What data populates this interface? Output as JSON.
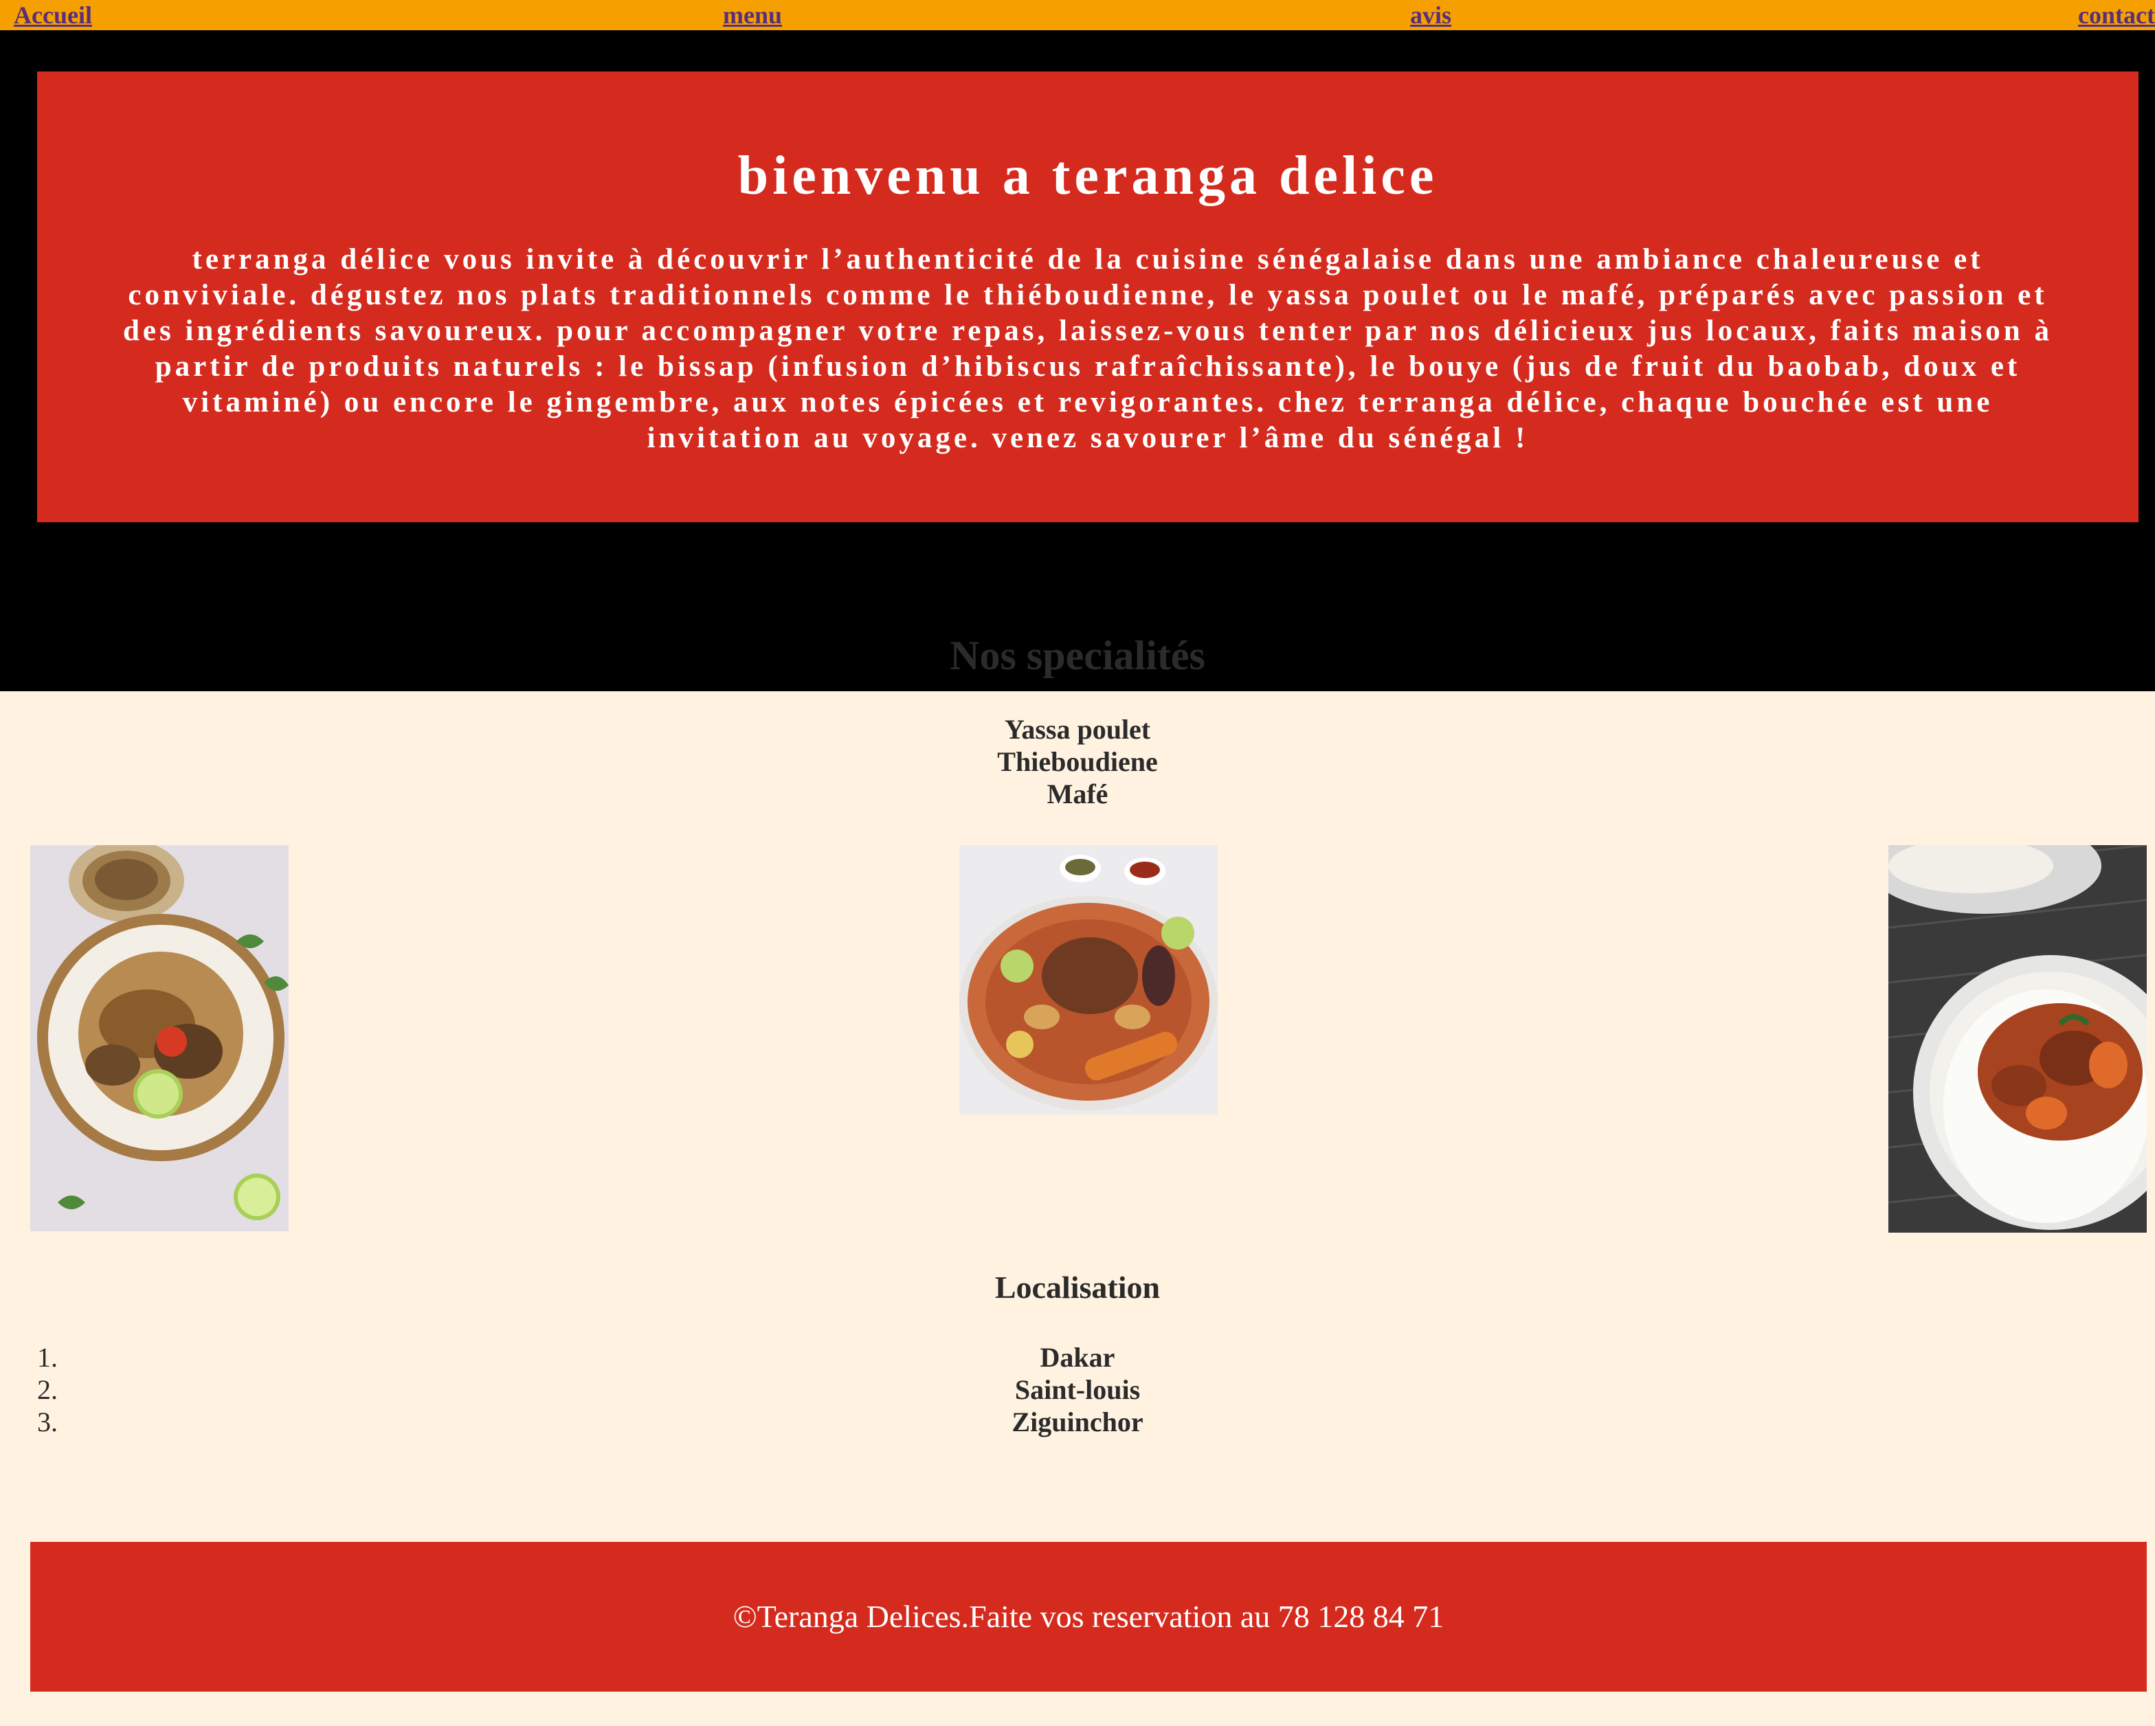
{
  "nav": {
    "items": [
      {
        "label": "Accueil"
      },
      {
        "label": "menu"
      },
      {
        "label": "avis"
      },
      {
        "label": "contact"
      }
    ]
  },
  "hero": {
    "title": "bienvenu a teranga delice",
    "text": "terranga délice vous invite à découvrir l’authenticité de la cuisine sénégalaise dans une ambiance chaleureuse et conviviale. dégustez nos plats traditionnels comme le thiéboudienne, le yassa poulet ou le mafé, préparés avec passion et des ingrédients savoureux. pour accompagner votre repas, laissez-vous tenter par nos délicieux jus locaux, faits maison à partir de produits naturels : le bissap (infusion d’hibiscus rafraîchissante), le bouye (jus de fruit du baobab, doux et vitaminé) ou encore le gingembre, aux notes épicées et revigorantes. chez terranga délice, chaque bouchée est une invitation au voyage. venez savourer l’âme du sénégal !"
  },
  "specialties": {
    "title": "Nos specialités",
    "dishes": [
      "Yassa poulet",
      "Thieboudiene",
      "Mafé"
    ]
  },
  "localisation": {
    "title": "Localisation",
    "numbers": [
      "1.",
      "2.",
      "3."
    ],
    "cities": [
      "Dakar",
      "Saint-louis",
      "Ziguinchor"
    ]
  },
  "footer": {
    "text": "©Teranga Delices.Faite vos reservation au 78 128 84 71"
  },
  "colors": {
    "nav_bg": "#f5a000",
    "nav_link": "#5a2f7a",
    "hero_bg": "#000000",
    "card_red": "#d52b1e",
    "page_bg": "#fff2e0"
  }
}
